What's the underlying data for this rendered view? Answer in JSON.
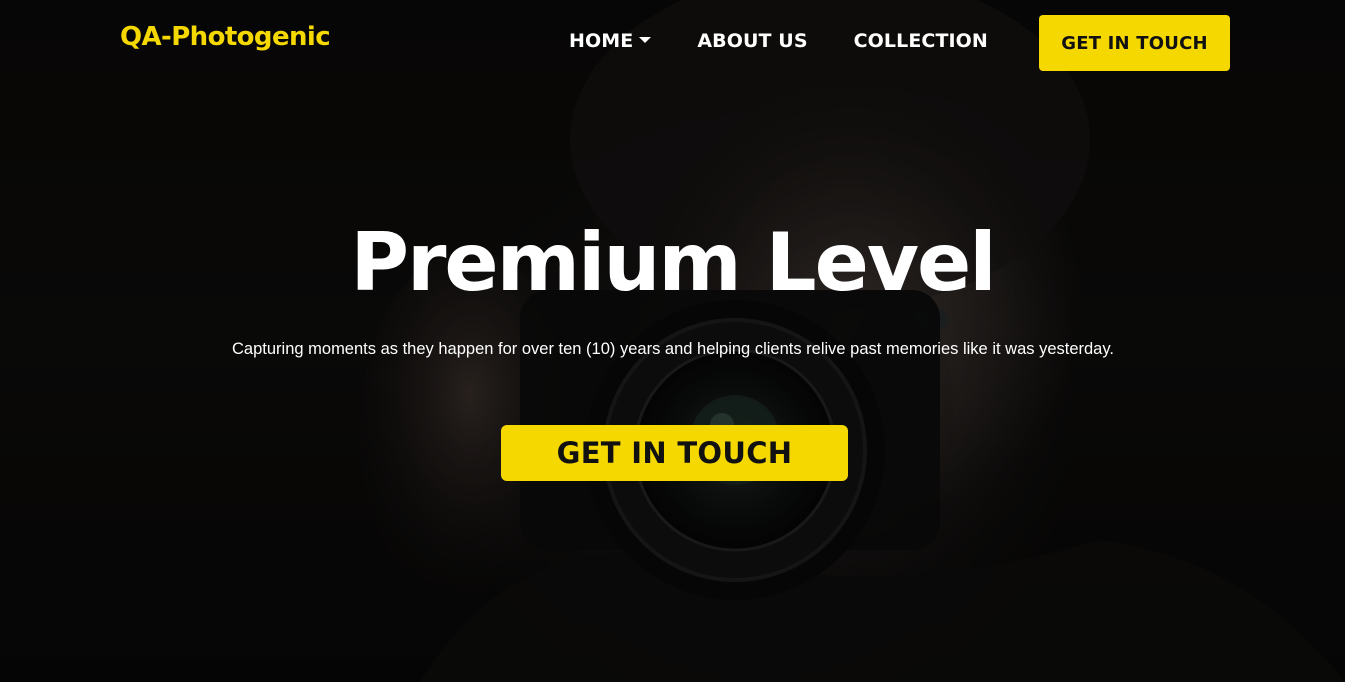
{
  "theme": {
    "accent": "#f5d800",
    "text": "#ffffff",
    "background": "#050505"
  },
  "nav": {
    "brand": "QA-Photogenic",
    "links": [
      {
        "label": "HOME",
        "has_dropdown": true
      },
      {
        "label": "ABOUT US",
        "has_dropdown": false
      },
      {
        "label": "COLLECTION",
        "has_dropdown": false
      }
    ],
    "cta_label": "GET IN TOUCH"
  },
  "hero": {
    "headline": "Premium Level",
    "subtitle": "Capturing moments as they happen for over ten (10) years and helping clients relive past memories like it was yesterday.",
    "cta_label": "GET IN TOUCH",
    "background_image": "photographer-with-camera"
  }
}
